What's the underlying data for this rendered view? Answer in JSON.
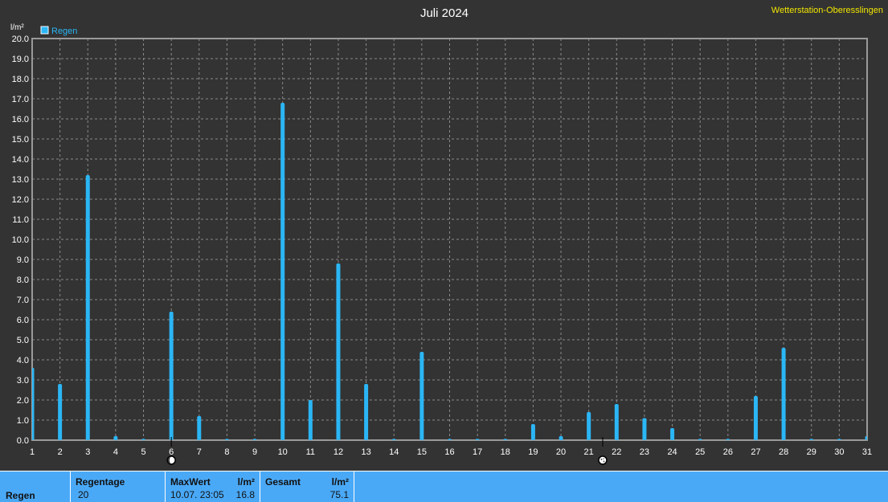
{
  "colors": {
    "background": "#333333",
    "plot_border": "#9a9a9a",
    "grid": "#8a8a8a",
    "bar": "#2bb6f5",
    "text": "#ffffff",
    "station": "#f2e600",
    "footer": "#4aa9f7"
  },
  "station_label": "Wetterstation-Oberesslingen",
  "moon_phase_icons": [
    {
      "day": 6,
      "icon": "new-moon-icon"
    },
    {
      "day": 21.5,
      "icon": "full-moon-icon"
    }
  ],
  "chart_data": {
    "type": "bar",
    "title": "Juli 2024",
    "ylabel": "l/m²",
    "xlabel": "",
    "legend": {
      "label": "Regen",
      "position": "top-left"
    },
    "grid": true,
    "xlim": [
      1,
      31
    ],
    "ylim": [
      0,
      20
    ],
    "yticks": [
      "0.0",
      "1.0",
      "2.0",
      "3.0",
      "4.0",
      "5.0",
      "6.0",
      "7.0",
      "8.0",
      "9.0",
      "10.0",
      "11.0",
      "12.0",
      "13.0",
      "14.0",
      "15.0",
      "16.0",
      "17.0",
      "18.0",
      "19.0",
      "20.0"
    ],
    "xticks": [
      "1",
      "2",
      "3",
      "4",
      "5",
      "6",
      "7",
      "8",
      "9",
      "10",
      "11",
      "12",
      "13",
      "14",
      "15",
      "16",
      "17",
      "18",
      "19",
      "20",
      "21",
      "22",
      "23",
      "24",
      "25",
      "26",
      "27",
      "28",
      "29",
      "30",
      "31"
    ],
    "series": [
      {
        "name": "Regen",
        "x": [
          1,
          2,
          3,
          4,
          5,
          6,
          7,
          8,
          9,
          10,
          11,
          12,
          13,
          14,
          15,
          16,
          17,
          18,
          19,
          20,
          21,
          22,
          23,
          24,
          25,
          26,
          27,
          28,
          29,
          30,
          31
        ],
        "values": [
          3.6,
          2.8,
          13.2,
          0.2,
          0.0,
          6.4,
          1.2,
          0.0,
          0.0,
          16.8,
          2.0,
          8.8,
          2.8,
          0.0,
          4.4,
          0.0,
          0.0,
          0.0,
          0.8,
          0.2,
          1.4,
          1.8,
          1.1,
          0.6,
          0.0,
          0.0,
          2.2,
          4.6,
          0.0,
          0.0,
          0.2
        ]
      }
    ]
  },
  "summary": {
    "row_label": "Regen",
    "rain_days_header": "Regentage",
    "rain_days_value": "20",
    "max_header": "MaxWert",
    "max_unit": "l/m²",
    "max_datetime": "10.07.  23:05",
    "max_value": "16.8",
    "total_header": "Gesamt",
    "total_unit": "l/m²",
    "total_value": "75.1"
  }
}
